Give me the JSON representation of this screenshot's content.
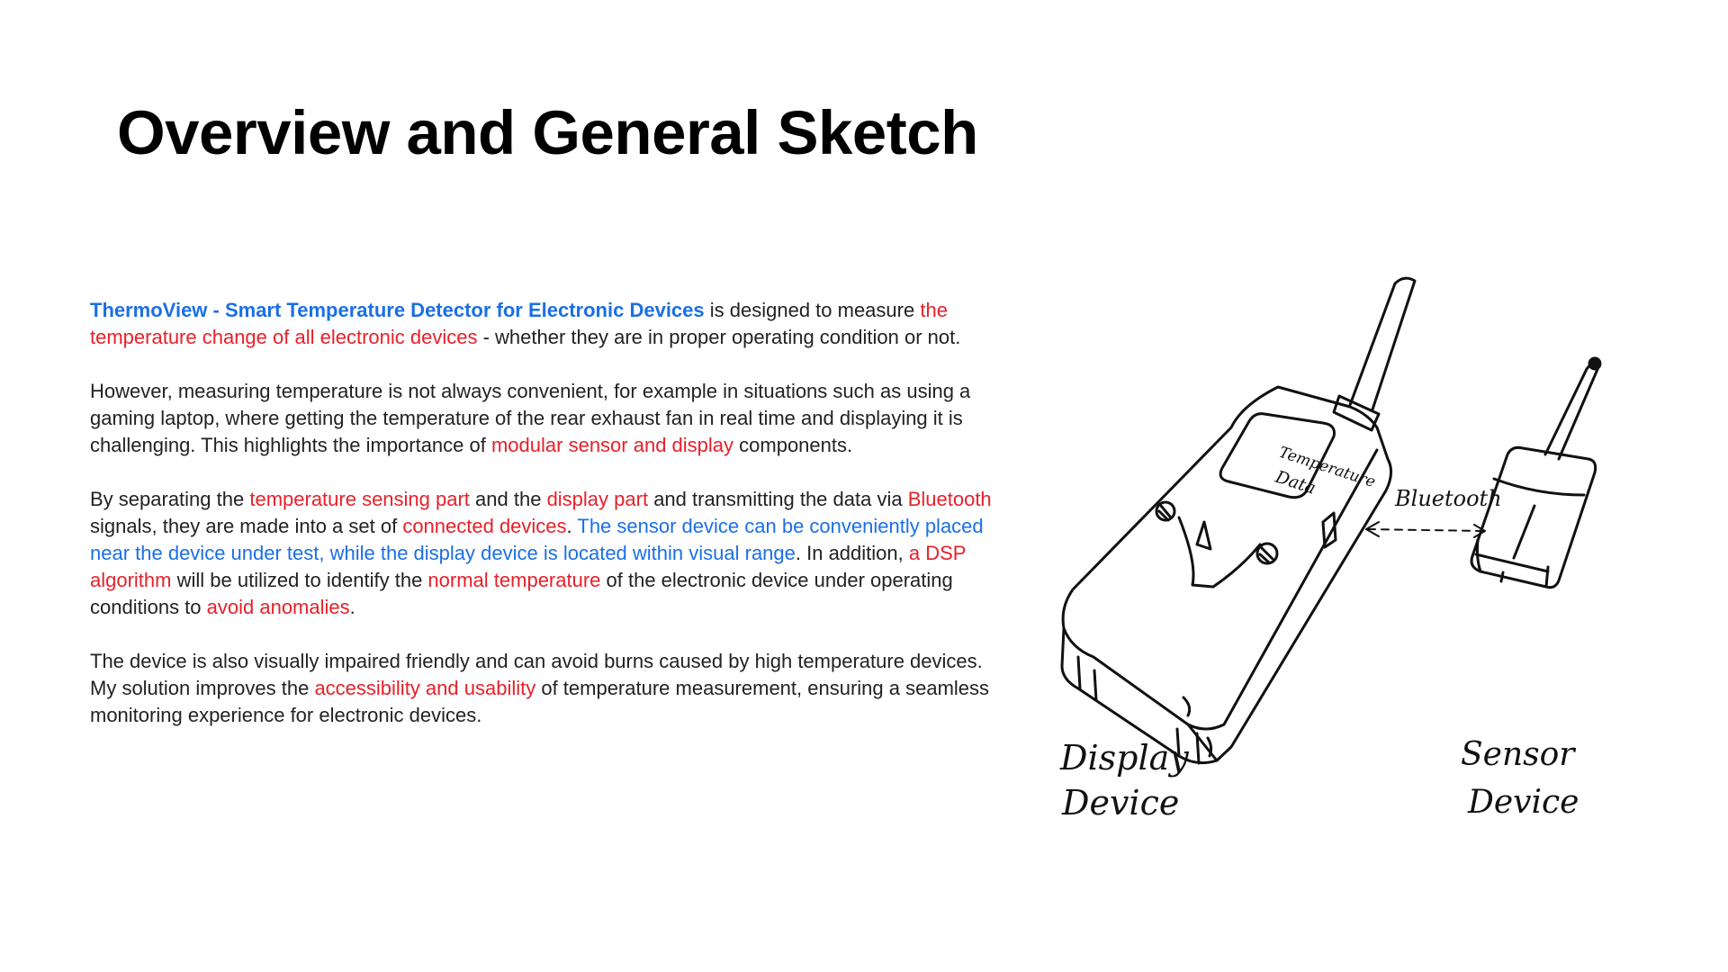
{
  "title": "Overview and General Sketch",
  "paragraphs": [
    {
      "segments": [
        {
          "text": "ThermoView - Smart Temperature Detector for Electronic Devices",
          "style": "blue-bold"
        },
        {
          "text": " is designed to measure ",
          "style": "plain"
        },
        {
          "text": "the temperature change of all electronic devices",
          "style": "red"
        },
        {
          "text": " - whether they are in proper operating condition or not.",
          "style": "plain"
        }
      ]
    },
    {
      "segments": [
        {
          "text": "However, measuring temperature is not always convenient, for example in situations such as using a gaming laptop, where getting the temperature of the rear exhaust fan in real time and displaying it is challenging. This highlights the importance of ",
          "style": "plain"
        },
        {
          "text": "modular sensor and display",
          "style": "red"
        },
        {
          "text": " components.",
          "style": "plain"
        }
      ]
    },
    {
      "segments": [
        {
          "text": "By separating the ",
          "style": "plain"
        },
        {
          "text": "temperature sensing part",
          "style": "red"
        },
        {
          "text": " and the ",
          "style": "plain"
        },
        {
          "text": "display part",
          "style": "red"
        },
        {
          "text": " and transmitting the data via ",
          "style": "plain"
        },
        {
          "text": "Bluetooth",
          "style": "red"
        },
        {
          "text": " signals, they are made into a set of ",
          "style": "plain"
        },
        {
          "text": "connected devices",
          "style": "red"
        },
        {
          "text": ". ",
          "style": "plain"
        },
        {
          "text": "The sensor device can be conveniently placed near the device under test, while the display device is located within visual range",
          "style": "blue"
        },
        {
          "text": ". In addition, ",
          "style": "plain"
        },
        {
          "text": "a DSP algorithm",
          "style": "red"
        },
        {
          "text": " will be utilized to identify the ",
          "style": "plain"
        },
        {
          "text": "normal temperature",
          "style": "red"
        },
        {
          "text": " of the electronic device under operating conditions to ",
          "style": "plain"
        },
        {
          "text": "avoid anomalies",
          "style": "red"
        },
        {
          "text": ".",
          "style": "plain"
        }
      ]
    },
    {
      "segments": [
        {
          "text": "The device is also visually impaired friendly and can avoid burns caused by high temperature devices. My solution improves the ",
          "style": "plain"
        },
        {
          "text": "accessibility and usability",
          "style": "red"
        },
        {
          "text": " of temperature measurement, ensuring a seamless monitoring experience for electronic devices.",
          "style": "plain"
        }
      ]
    }
  ],
  "sketch": {
    "screen_text_line1": "Temperature",
    "screen_text_line2": "Data",
    "bluetooth_label": "Bluetooth",
    "display_label_line1": "Display",
    "display_label_line2": "Device",
    "sensor_label_line1": "Sensor",
    "sensor_label_line2": "Device"
  },
  "colors": {
    "highlight_blue": "#1b6fe6",
    "highlight_red": "#e8202a",
    "body_text": "#222222",
    "title": "#000000"
  }
}
